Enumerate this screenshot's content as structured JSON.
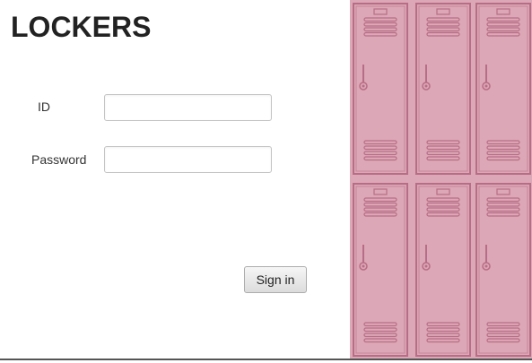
{
  "app": {
    "title": "LOCKERS"
  },
  "form": {
    "id_label": "ID",
    "id_value": "",
    "password_label": "Password",
    "password_value": "",
    "signin_label": "Sign in"
  },
  "illustration": {
    "icon": "lockers-illustration",
    "colors": {
      "fill": "#dca7b6",
      "stroke": "#b86d86"
    }
  }
}
